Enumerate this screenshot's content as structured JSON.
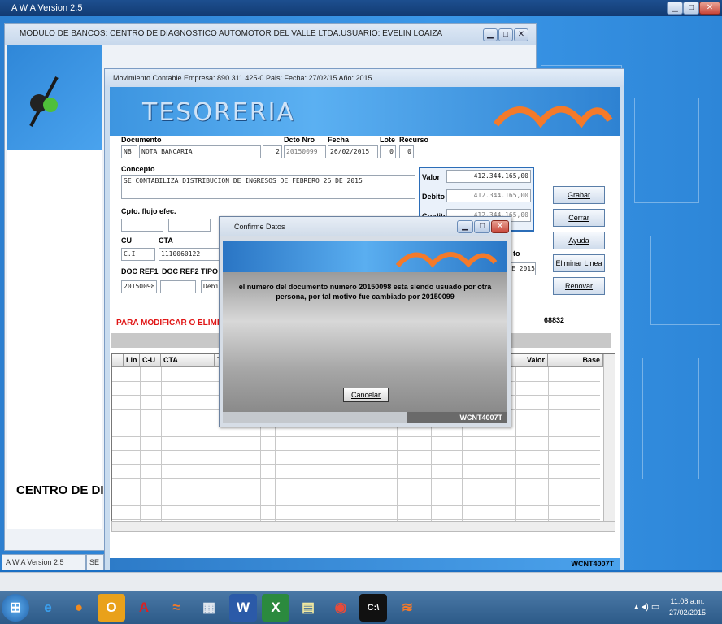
{
  "outer": {
    "title": "A W A Version 2.5"
  },
  "banks_window": {
    "title": "MODULO DE BANCOS: CENTRO DE DIAGNOSTICO AUTOMOTOR DEL VALLE LTDA.USUARIO: EVELIN LOAIZA",
    "side_caption": "CENTRO DE DIA"
  },
  "tesoreria": {
    "title": "Movimiento Contable  Empresa: 890.311.425-0  Pais:   Fecha: 27/02/15  Año: 2015",
    "logo": "TESORERIA",
    "labels": {
      "documento": "Documento",
      "dcto_nro": "Dcto Nro",
      "fecha": "Fecha",
      "lote": "Lote",
      "recurso": "Recurso",
      "concepto": "Concepto",
      "cpto_flujo": "Cpto. flujo efec.",
      "cu": "CU",
      "cta": "CTA",
      "doc_ref1": "DOC REF1",
      "doc_ref2": "DOC REF2",
      "tipo": "TIPO",
      "valor": "Valor",
      "debito": "Debito",
      "credito": "Credito"
    },
    "fields": {
      "doc_code": "NB",
      "doc_name": "NOTA BANCARIA",
      "doc_num_small": "2",
      "dcto_nro": "20150099",
      "fecha": "26/02/2015",
      "lote": "0",
      "recurso": "0",
      "concepto": "SE CONTABILIZA DISTRIBUCION DE INGRESOS DE FEBRERO 26 DE 2015",
      "cu": "C.I",
      "cta": "1110060122",
      "doc_ref1": "20150098",
      "doc_ref2": "",
      "tipo": "Debi",
      "valor": "412.344.165,00",
      "debito": "412.344.165,00",
      "credito": "412.344.165,00",
      "right_partial_label": "to",
      "right_partial_value": "E 2015"
    },
    "buttons": [
      "Grabar",
      "Cerrar",
      "Ayuda",
      "Eliminar Linea",
      "Renovar"
    ],
    "warning": "PARA MODIFICAR O ELIMINA",
    "code_number": "68832",
    "grid": {
      "columns": [
        "Lin",
        "C-U",
        "CTA",
        "T",
        "Valor",
        "Base"
      ]
    },
    "bottom_code": "WCNT4007T"
  },
  "dialog": {
    "title": "Confirme Datos",
    "message": "el numero del documento numero 20150098 esta siendo usuado por otra persona, por tal motivo fue cambiado por 20150099",
    "cancel": "Cancelar",
    "code": "WCNT4007T"
  },
  "taskbar_tabs": {
    "tab1": "A W A Version 2.5",
    "tab2": "SE"
  },
  "taskbar": {
    "time": "11:08 a.m.",
    "date": "27/02/2015",
    "items": [
      "start-icon",
      "ie-icon",
      "firefox-icon",
      "outlook-icon",
      "acrobat-icon",
      "awa-icon",
      "calculator-icon",
      "word-icon",
      "excel-icon",
      "notepad-icon",
      "chrome-icon",
      "cmd-icon",
      "awa2-icon"
    ],
    "colors": {
      "taskbar": "#3a6896",
      "accent": "#1a6fc4",
      "warning": "#e01515"
    }
  }
}
